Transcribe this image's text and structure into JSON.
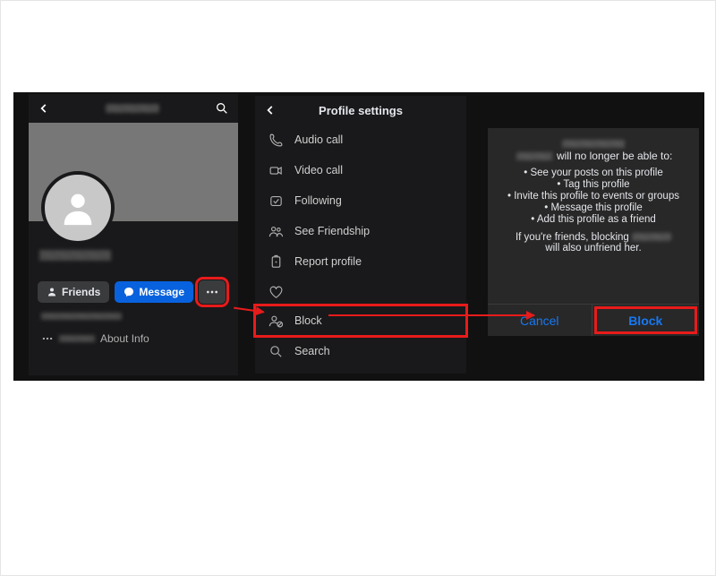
{
  "panel1": {
    "friends_label": "Friends",
    "message_label": "Message",
    "about_label": "About Info"
  },
  "panel2": {
    "title": "Profile settings",
    "items": {
      "audio": "Audio call",
      "video": "Video call",
      "following": "Following",
      "friendship": "See Friendship",
      "report": "Report profile",
      "block": "Block",
      "search": "Search"
    }
  },
  "panel3": {
    "heading_suffix": "will no longer be able to:",
    "bullets": [
      "See your posts on this profile",
      "Tag this profile",
      "Invite this profile to events or groups",
      "Message this profile",
      "Add this profile as a friend"
    ],
    "footer_prefix": "If you're friends, blocking",
    "footer_suffix": "will also unfriend her.",
    "cancel_label": "Cancel",
    "block_label": "Block"
  }
}
